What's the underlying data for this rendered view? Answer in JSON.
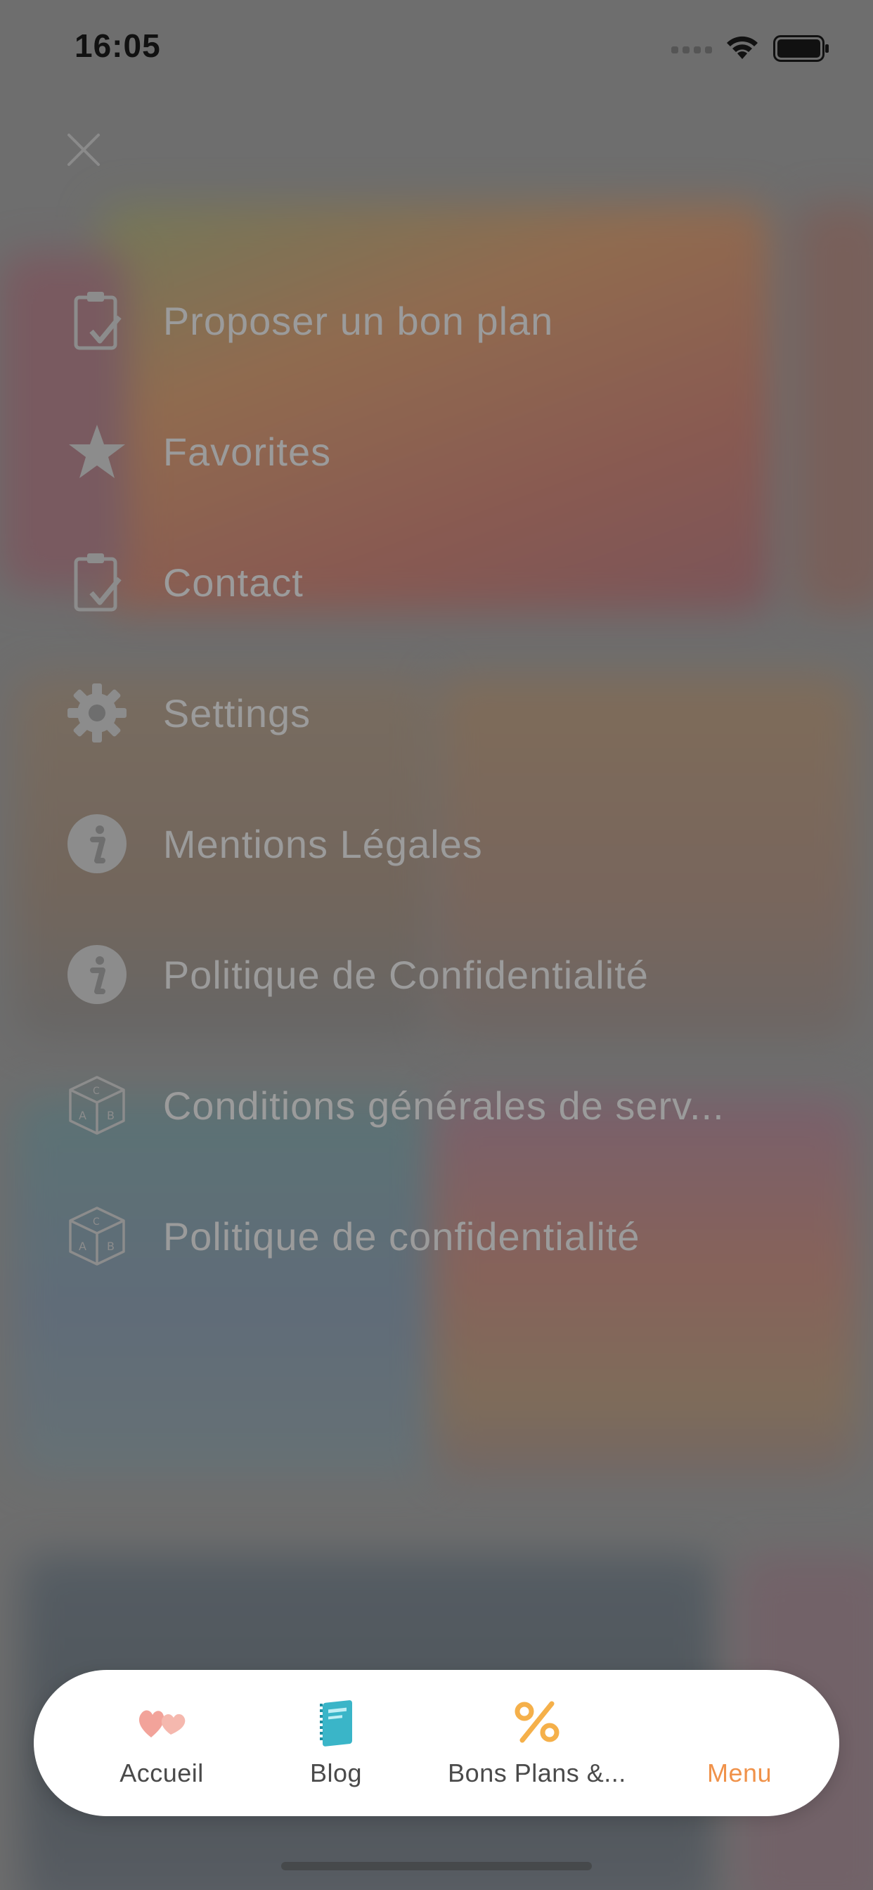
{
  "status_bar": {
    "time": "16:05"
  },
  "header": {
    "close_icon": "close-icon"
  },
  "menu": {
    "items": [
      {
        "label": "Proposer un bon plan",
        "icon": "clipboard-check-icon"
      },
      {
        "label": "Favorites",
        "icon": "star-icon"
      },
      {
        "label": "Contact",
        "icon": "clipboard-check-icon"
      },
      {
        "label": "Settings",
        "icon": "gear-icon"
      },
      {
        "label": "Mentions Légales",
        "icon": "info-icon"
      },
      {
        "label": "Politique de Confidentialité",
        "icon": "info-icon"
      },
      {
        "label": "Conditions générales de serv...",
        "icon": "abc-cube-icon"
      },
      {
        "label": "Politique de confidentialité",
        "icon": "abc-cube-icon"
      }
    ]
  },
  "tab_bar": {
    "tabs": [
      {
        "label": "Accueil",
        "icon": "hearts-icon"
      },
      {
        "label": "Blog",
        "icon": "notebook-icon"
      },
      {
        "label": "Bons Plans &...",
        "icon": "percent-icon"
      },
      {
        "label": "Menu",
        "icon": "none",
        "active": true
      }
    ]
  },
  "colors": {
    "accent": "#f0924a",
    "menu_text": "#9b9b9b",
    "overlay": "#6e6e6e",
    "blog_icon": "#3ab5c8",
    "hearts_icon": "#f2a39a"
  }
}
